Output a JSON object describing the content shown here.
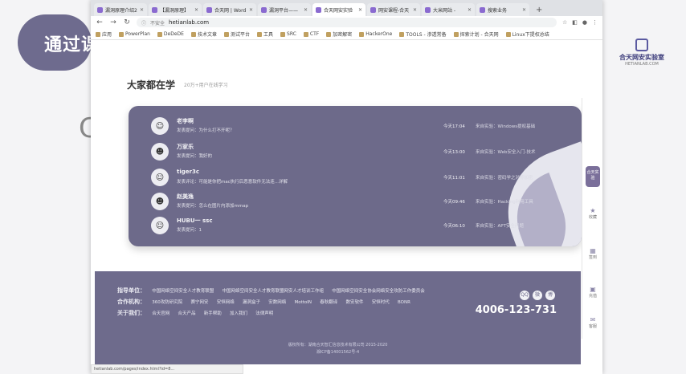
{
  "slide": {
    "title": "通过课",
    "logo_name": "合天网安实验室",
    "logo_sub": "HETIANLAB.COM"
  },
  "browser": {
    "tabs": [
      {
        "label": "漏洞原理介绍2",
        "active": false
      },
      {
        "label": "【漏洞原理】",
        "active": false
      },
      {
        "label": "合天网 | Word",
        "active": false
      },
      {
        "label": "漏洞平台——",
        "active": false
      },
      {
        "label": "合天网安实验",
        "active": true
      },
      {
        "label": "网安课程-合天",
        "active": false
      },
      {
        "label": "大米网站 -",
        "active": false
      },
      {
        "label": "搜索业务",
        "active": false
      }
    ],
    "new_tab": "+",
    "url_warning": "不安全",
    "url": "hetianlab.com",
    "bookmarks": [
      "应用",
      "PowerPlan",
      "DeDeDE",
      "技术文章",
      "测试平台",
      "工具",
      "SRC",
      "CTF",
      "加密解密",
      "HackerOne",
      "TOOLS - 渗透常备",
      "探索计划 - 合天网",
      "Linux下提权总结"
    ],
    "status_url": "hetianlab.com/pages/index.html?id=8..."
  },
  "section": {
    "title": "大家都在学",
    "subtitle": "20万+用户在线学习"
  },
  "learners": [
    {
      "name": "老李啊",
      "topic": "发表提问：为什么打不开呢？",
      "time": "今天17:04",
      "course_label": "来自实验：",
      "course": "Windows提权基础",
      "avatar": "☺"
    },
    {
      "name": "万家乐",
      "topic": "发表提问：我好的",
      "time": "今天13:00",
      "course_label": "来自实验：",
      "course": "Web安全入门-技术",
      "avatar": "☻"
    },
    {
      "name": "tiger3c",
      "topic": "发表评论：可能是你把mac执行后恶意软件无法连...详解",
      "time": "今天11:01",
      "course_label": "来自实验：",
      "course": "密码学之对称加密",
      "avatar": "☺"
    },
    {
      "name": "赵美逸",
      "topic": "发表提问：怎么在图片内添加mmap",
      "time": "今天09:46",
      "course_label": "来自实验：",
      "course": "Hacking利用工具",
      "avatar": "☻"
    },
    {
      "name": "HUBU一 ssc",
      "topic": "发表提问：1",
      "time": "今天06:10",
      "course_label": "来自实验：",
      "course": "APT安全问题",
      "avatar": "☺"
    }
  ],
  "sidebar": {
    "items": [
      "收藏",
      "签到",
      "充值",
      "客服"
    ],
    "highlight": "合天实验"
  },
  "footer": {
    "guide_label": "指导单位：",
    "guide_items": [
      "中国网络空间安全人才教育联盟",
      "中国网络空间安全人才教育联盟网安人才培训工作组",
      "中国网络空间安全协会网络安全攻防工作委员会"
    ],
    "partner_label": "合作机构：",
    "partner_items": [
      "360攻防研究院",
      "赛宁网安",
      "安恒网络",
      "漏洞盒子",
      "安数网络",
      "MottoIN",
      "春秋翻译",
      "数安软件",
      "安恒时代",
      "BONR"
    ],
    "about_label": "关于我们：",
    "about_items": [
      "合天官网",
      "合天产品",
      "新手帮助",
      "加入我们",
      "法律声明"
    ],
    "phone": "4006-123-731",
    "socials": [
      "QQ",
      "微",
      "博"
    ],
    "copyright": "版权所有：湖南合天智汇信息技术有限公司 2015-2020",
    "icp": "湘ICP备14001562号-4"
  }
}
